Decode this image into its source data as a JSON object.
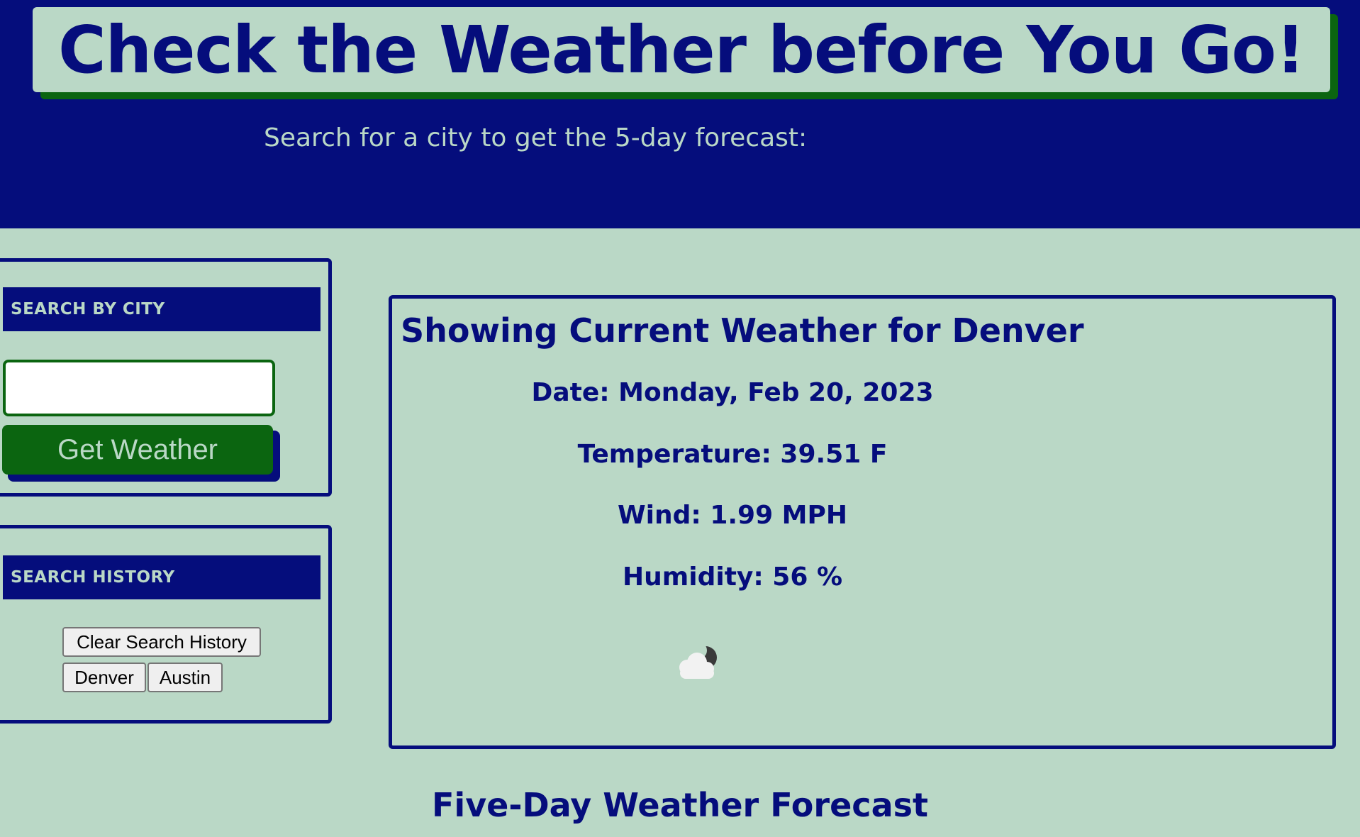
{
  "header": {
    "title": "Check the Weather before You Go!",
    "subtitle": "Search for a city to get the 5-day forecast:"
  },
  "search_panel": {
    "heading": "SEARCH BY CITY",
    "input_value": "",
    "button_label": "Get Weather"
  },
  "history_panel": {
    "heading": "SEARCH HISTORY",
    "clear_label": "Clear Search History",
    "cities": [
      "Denver",
      "Austin"
    ]
  },
  "current": {
    "title": "Showing Current Weather for Denver",
    "date": "Date: Monday, Feb 20, 2023",
    "temperature": "Temperature: 39.51 F",
    "wind": "Wind: 1.99 MPH",
    "humidity": "Humidity: 56 %",
    "icon": "partly-cloudy-night-icon"
  },
  "forecast": {
    "title": "Five-Day Weather Forecast"
  },
  "colors": {
    "navy": "#050d7c",
    "green": "#0b6510",
    "mint": "#bad8c6"
  }
}
